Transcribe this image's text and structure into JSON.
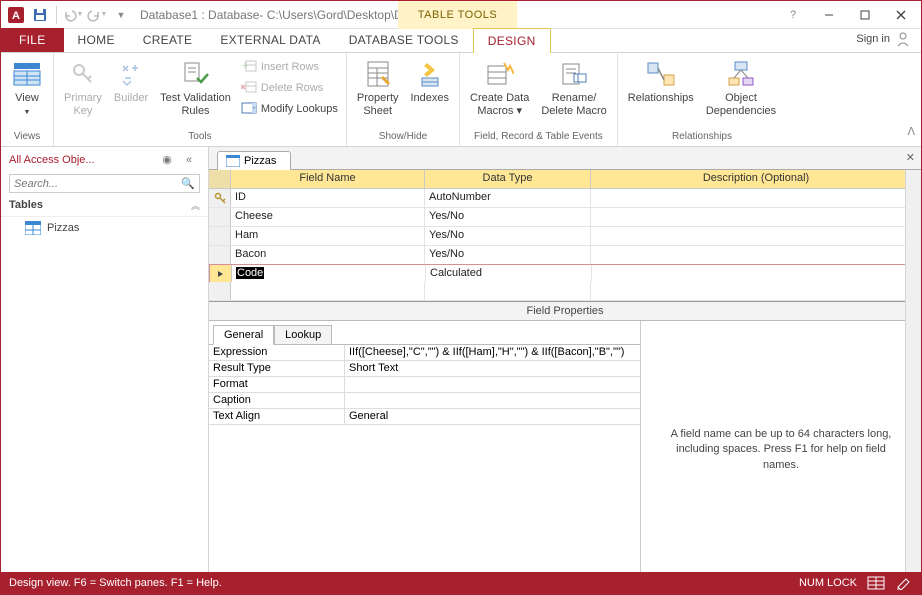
{
  "title": "Database1 : Database- C:\\Users\\Gord\\Desktop\\D...",
  "contextual_tab": "TABLE TOOLS",
  "tabs": {
    "file": "FILE",
    "home": "HOME",
    "create": "CREATE",
    "external": "EXTERNAL DATA",
    "dbtools": "DATABASE TOOLS",
    "design": "DESIGN"
  },
  "signin": "Sign in",
  "ribbon": {
    "views": {
      "view": "View",
      "label": "Views"
    },
    "tools": {
      "primary": "Primary\nKey",
      "builder": "Builder",
      "test": "Test Validation\nRules",
      "insert": "Insert Rows",
      "delete": "Delete Rows",
      "modify": "Modify Lookups",
      "label": "Tools"
    },
    "showhide": {
      "prop": "Property\nSheet",
      "idx": "Indexes",
      "label": "Show/Hide"
    },
    "events": {
      "macros": "Create Data\nMacros ▾",
      "rename": "Rename/\nDelete Macro",
      "label": "Field, Record & Table Events"
    },
    "rel": {
      "rel": "Relationships",
      "obj": "Object\nDependencies",
      "label": "Relationships"
    }
  },
  "nav": {
    "header": "All Access Obje...",
    "search": "Search...",
    "group": "Tables",
    "item": "Pizzas"
  },
  "object_tab": "Pizzas",
  "grid": {
    "headers": {
      "fn": "Field Name",
      "dt": "Data Type",
      "desc": "Description (Optional)"
    },
    "rows": [
      {
        "pk": true,
        "fn": "ID",
        "dt": "AutoNumber"
      },
      {
        "fn": "Cheese",
        "dt": "Yes/No"
      },
      {
        "fn": "Ham",
        "dt": "Yes/No"
      },
      {
        "fn": "Bacon",
        "dt": "Yes/No"
      },
      {
        "fn": "Code",
        "dt": "Calculated",
        "selected": true
      }
    ]
  },
  "fp": {
    "section": "Field Properties",
    "tabs": {
      "general": "General",
      "lookup": "Lookup"
    },
    "rows": [
      {
        "k": "Expression",
        "v": "IIf([Cheese],\"C\",\"\") & IIf([Ham],\"H\",\"\") & IIf([Bacon],\"B\",\"\")"
      },
      {
        "k": "Result Type",
        "v": "Short Text"
      },
      {
        "k": "Format",
        "v": ""
      },
      {
        "k": "Caption",
        "v": ""
      },
      {
        "k": "Text Align",
        "v": "General"
      }
    ],
    "help": "A field name can be up to 64 characters long, including spaces. Press F1 for help on field names."
  },
  "status": {
    "left": "Design view.  F6 = Switch panes.  F1 = Help.",
    "numlock": "NUM LOCK"
  }
}
